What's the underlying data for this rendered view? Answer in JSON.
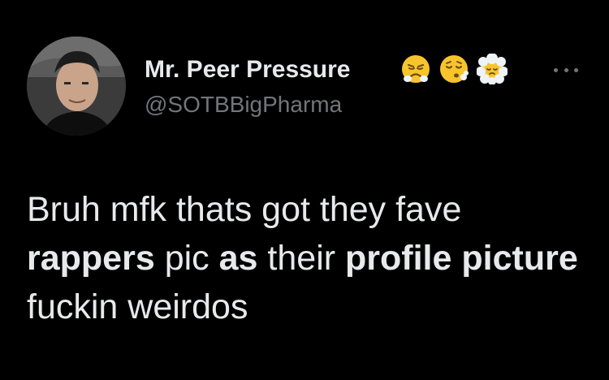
{
  "user": {
    "display_name": "Mr. Peer Pressure",
    "handle": "@SOTBBigPharma",
    "name_emojis": [
      "face-with-steam-from-nose",
      "face-exhaling",
      "face-in-clouds"
    ]
  },
  "menu": {
    "icon": "more-horizontal-icon"
  },
  "tweet": {
    "segments": [
      {
        "text": "Bruh mfk thats got they fave ",
        "bold": false
      },
      {
        "text": "rappers",
        "bold": true
      },
      {
        "text": " pic ",
        "bold": false
      },
      {
        "text": "as",
        "bold": true
      },
      {
        "text": " their ",
        "bold": false
      },
      {
        "text": "profile",
        "bold": true
      },
      {
        "text": " ",
        "bold": false
      },
      {
        "text": "picture",
        "bold": true
      },
      {
        "text": " fuckin weirdos",
        "bold": false
      }
    ]
  },
  "colors": {
    "background": "#000000",
    "text_primary": "#e7e9ea",
    "text_secondary": "#71767b"
  }
}
